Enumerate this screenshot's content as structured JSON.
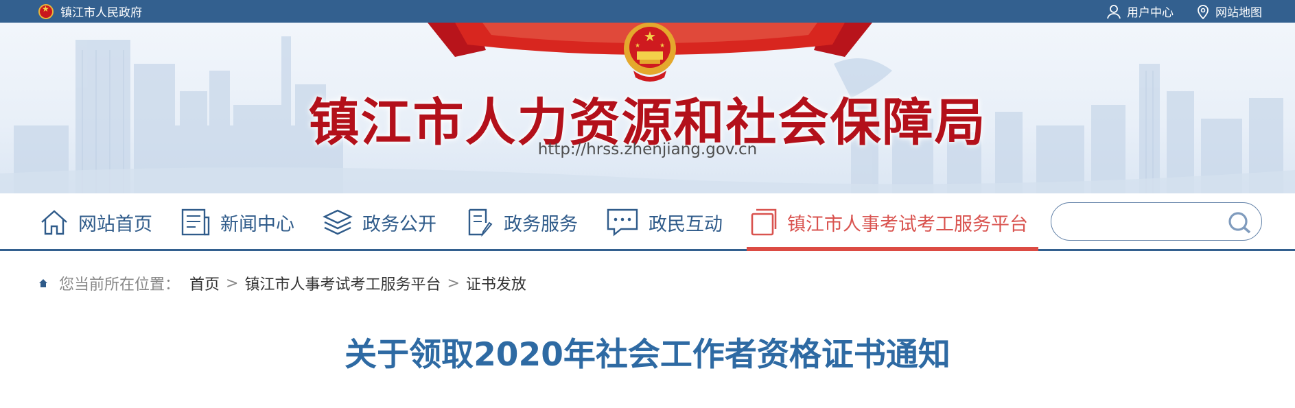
{
  "topbar": {
    "gov_name": "镇江市人民政府",
    "user_center": "用户中心",
    "site_map": "网站地图",
    "icons": [
      "emblem-icon",
      "user-icon",
      "location-icon"
    ]
  },
  "banner": {
    "title": "镇江市人力资源和社会保障局",
    "url": "http://hrss.zhenjiang.gov.cn"
  },
  "nav": {
    "items": [
      {
        "label": "网站首页",
        "icon": "home-icon"
      },
      {
        "label": "新闻中心",
        "icon": "news-icon"
      },
      {
        "label": "政务公开",
        "icon": "layers-icon"
      },
      {
        "label": "政务服务",
        "icon": "document-edit-icon"
      },
      {
        "label": "政民互动",
        "icon": "chat-icon"
      },
      {
        "label": "镇江市人事考试考工服务平台",
        "icon": "square-icon",
        "active": true
      }
    ],
    "search_placeholder": ""
  },
  "breadcrumb": {
    "lead": "您当前所在位置：",
    "items": [
      "首页",
      "镇江市人事考试考工服务平台",
      "证书发放"
    ],
    "separator": ">"
  },
  "article": {
    "title": "关于领取2020年社会工作者资格证书通知"
  },
  "colors": {
    "top_bar": "#33608f",
    "nav_text": "#2f5b8a",
    "active": "#d9534f",
    "title_red": "#b3101a",
    "article_title": "#2e6aa3"
  }
}
